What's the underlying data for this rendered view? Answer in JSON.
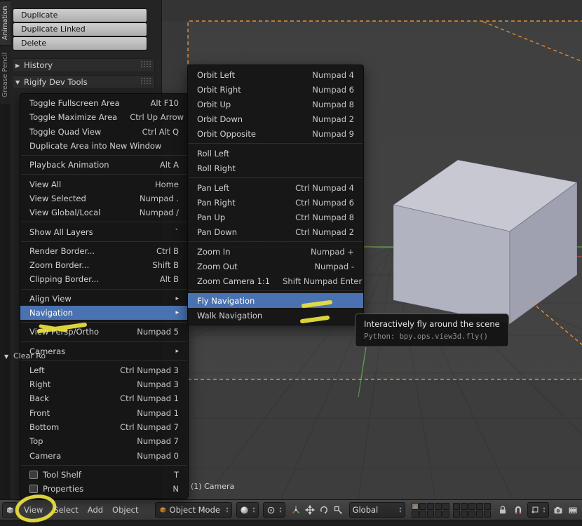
{
  "colors": {
    "menu_highlight_blue": "#4a72b0",
    "camera_frame_orange": "#ef9433",
    "annotation_yellow": "#ebe23e",
    "axis_green": "#59a04d",
    "axis_red": "#a84848"
  },
  "tool_shelf": {
    "tabs": [
      {
        "label": "Animation",
        "active": true
      },
      {
        "label": "Grease Pencil",
        "active": false
      }
    ],
    "operator_buttons": [
      {
        "label": "Duplicate"
      },
      {
        "label": "Duplicate Linked"
      },
      {
        "label": "Delete"
      }
    ],
    "panels": [
      {
        "label": "History",
        "state": "collapsed"
      },
      {
        "label": "Rigify Dev Tools",
        "state": "expanded"
      }
    ],
    "partial_panel_label": "Clear Ro"
  },
  "view_menu": {
    "items": [
      {
        "label": "Toggle Fullscreen Area",
        "shortcut": "Alt F10"
      },
      {
        "label": "Toggle Maximize Area",
        "shortcut": "Ctrl Up Arrow"
      },
      {
        "label": "Toggle Quad View",
        "shortcut": "Ctrl Alt Q"
      },
      {
        "label": "Duplicate Area into New Window"
      },
      {
        "separator": true
      },
      {
        "label": "Playback Animation",
        "shortcut": "Alt A"
      },
      {
        "separator": true
      },
      {
        "label": "View All",
        "shortcut": "Home"
      },
      {
        "label": "View Selected",
        "shortcut": "Numpad ."
      },
      {
        "label": "View Global/Local",
        "shortcut": "Numpad /"
      },
      {
        "separator": true
      },
      {
        "label": "Show All Layers",
        "shortcut": "`"
      },
      {
        "separator": true
      },
      {
        "label": "Render Border...",
        "shortcut": "Ctrl B"
      },
      {
        "label": "Zoom Border...",
        "shortcut": "Shift B"
      },
      {
        "label": "Clipping Border...",
        "shortcut": "Alt B"
      },
      {
        "separator": true
      },
      {
        "label": "Align View",
        "submenu": true
      },
      {
        "label": "Navigation",
        "submenu": true,
        "highlighted": true
      },
      {
        "separator": true
      },
      {
        "label": "View Persp/Ortho",
        "shortcut": "Numpad 5"
      },
      {
        "separator": true
      },
      {
        "label": "Cameras",
        "submenu": true
      },
      {
        "separator": true
      },
      {
        "label": "Left",
        "shortcut": "Ctrl Numpad 3"
      },
      {
        "label": "Right",
        "shortcut": "Numpad 3"
      },
      {
        "label": "Back",
        "shortcut": "Ctrl Numpad 1"
      },
      {
        "label": "Front",
        "shortcut": "Numpad 1"
      },
      {
        "label": "Bottom",
        "shortcut": "Ctrl Numpad 7"
      },
      {
        "label": "Top",
        "shortcut": "Numpad 7"
      },
      {
        "label": "Camera",
        "shortcut": "Numpad 0"
      },
      {
        "separator": true
      },
      {
        "label": "Tool Shelf",
        "shortcut": "T",
        "checkbox": true
      },
      {
        "label": "Properties",
        "shortcut": "N",
        "checkbox": true
      }
    ]
  },
  "navigation_submenu": {
    "items": [
      {
        "label": "Orbit Left",
        "shortcut": "Numpad 4"
      },
      {
        "label": "Orbit Right",
        "shortcut": "Numpad 6"
      },
      {
        "label": "Orbit Up",
        "shortcut": "Numpad 8"
      },
      {
        "label": "Orbit Down",
        "shortcut": "Numpad 2"
      },
      {
        "label": "Orbit Opposite",
        "shortcut": "Numpad 9"
      },
      {
        "separator": true
      },
      {
        "label": "Roll Left"
      },
      {
        "label": "Roll Right"
      },
      {
        "separator": true
      },
      {
        "label": "Pan Left",
        "shortcut": "Ctrl Numpad 4"
      },
      {
        "label": "Pan Right",
        "shortcut": "Ctrl Numpad 6"
      },
      {
        "label": "Pan Up",
        "shortcut": "Ctrl Numpad 8"
      },
      {
        "label": "Pan Down",
        "shortcut": "Ctrl Numpad 2"
      },
      {
        "separator": true
      },
      {
        "label": "Zoom In",
        "shortcut": "Numpad +"
      },
      {
        "label": "Zoom Out",
        "shortcut": "Numpad -"
      },
      {
        "label": "Zoom Camera 1:1",
        "shortcut": "Shift Numpad Enter"
      },
      {
        "separator": true
      },
      {
        "label": "Fly Navigation",
        "highlighted": true
      },
      {
        "label": "Walk Navigation"
      }
    ]
  },
  "tooltip": {
    "title": "Interactively fly around the scene",
    "python": "Python: bpy.ops.view3d.fly()"
  },
  "viewport": {
    "info_text": "(1) Camera"
  },
  "header": {
    "menus": [
      {
        "label": "View"
      },
      {
        "label": "Select"
      },
      {
        "label": "Add"
      },
      {
        "label": "Object"
      }
    ],
    "mode_dropdown": {
      "value": "Object Mode"
    },
    "orientation_dropdown": {
      "value": "Global"
    },
    "layers": {
      "total": 20,
      "active_index": 0
    },
    "icon_names": [
      "editor-type-icon",
      "cube-mode-icon",
      "shading-sphere-icon",
      "pivot-point-icon",
      "manipulator-axis-icon",
      "translate-icon",
      "rotate-icon",
      "scale-icon",
      "lock-icon",
      "magnet-icon",
      "snap-element-icon",
      "render-still-icon",
      "render-anim-icon"
    ]
  },
  "annotations": {
    "marks": [
      "underline-navigation",
      "dash-fly-navigation",
      "dash-walk-navigation",
      "circle-view-menu"
    ]
  }
}
